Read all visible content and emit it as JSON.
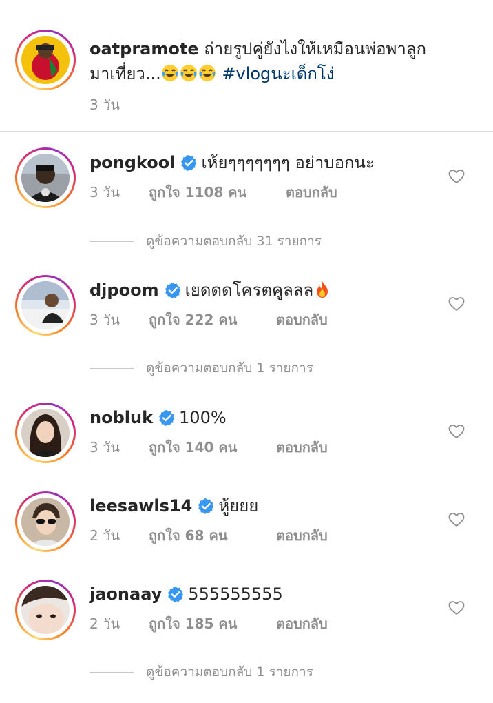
{
  "post": {
    "username": "oatpramote",
    "caption_line1": "ถ่ายรูปคู่ยังไงให้เหมือนพ่อพาลูก",
    "caption_line2_prefix": "มาเที่ยว...",
    "emojis": [
      "face-with-tears-of-joy-icon",
      "face-with-tears-of-joy-icon",
      "face-with-tears-of-joy-icon"
    ],
    "hashtag": "#vlogนะเด็กโง่",
    "time": "3 วัน"
  },
  "comments": [
    {
      "username": "pongkool",
      "verified": true,
      "text": "เห้ยๆๆๆๆๆๆๆ อย่าบอกนะ",
      "time": "3 วัน",
      "likes": "ถูกใจ 1108 คน",
      "reply": "ตอบกลับ",
      "view_replies": "ดูข้อความตอบกลับ 31 รายการ"
    },
    {
      "username": "djpoom",
      "verified": true,
      "text": "เยดดดโครตคูลลล",
      "text_emoji": "fire-icon",
      "time": "3 วัน",
      "likes": "ถูกใจ 222 คน",
      "reply": "ตอบกลับ",
      "view_replies": "ดูข้อความตอบกลับ 1 รายการ"
    },
    {
      "username": "nobluk",
      "verified": true,
      "text": "100%",
      "time": "3 วัน",
      "likes": "ถูกใจ 140 คน",
      "reply": "ตอบกลับ"
    },
    {
      "username": "leesawls14",
      "verified": true,
      "text": "หู้ยยย",
      "time": "2 วัน",
      "likes": "ถูกใจ 68 คน",
      "reply": "ตอบกลับ"
    },
    {
      "username": "jaonaay",
      "verified": true,
      "text": "555555555",
      "time": "2 วัน",
      "likes": "ถูกใจ 185 คน",
      "reply": "ตอบกลับ",
      "view_replies": "ดูข้อความตอบกลับ 1 รายการ"
    }
  ],
  "colors": {
    "text": "#262626",
    "secondary_text": "#8e8e8e",
    "hashtag": "#00376b",
    "verified_badge": "#3897f0",
    "divider": "#dbdbdb"
  }
}
